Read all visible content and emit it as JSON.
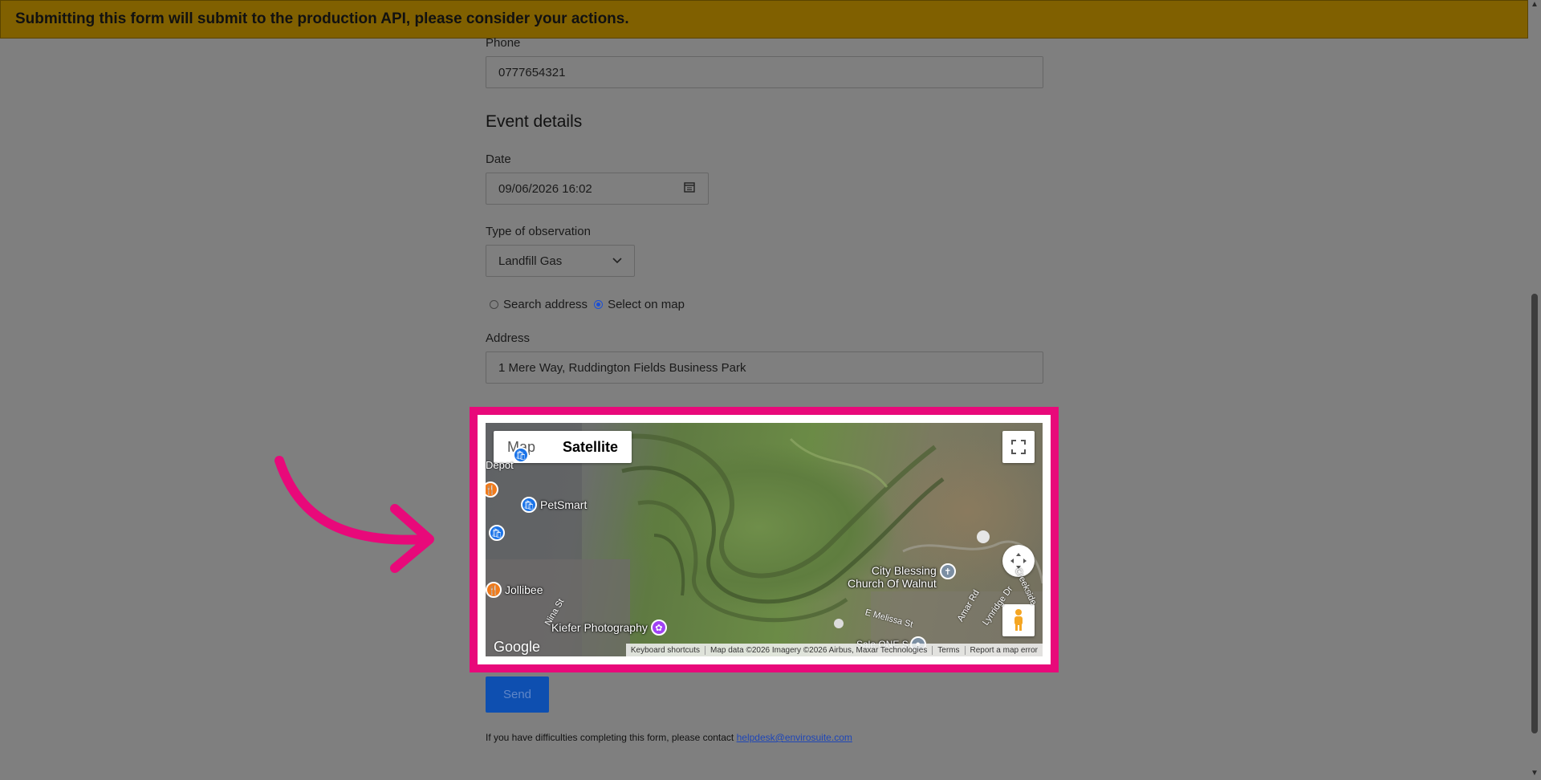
{
  "banner": {
    "text": "Submitting this form will submit to the production API, please consider your actions."
  },
  "phone": {
    "label": "Phone",
    "value": "0777654321"
  },
  "event": {
    "title": "Event details",
    "date_label": "Date",
    "date_value": "09/06/2026 16:02",
    "type_label": "Type of observation",
    "type_value": "Landfill Gas",
    "location_options": [
      {
        "label": "Search address",
        "selected": false
      },
      {
        "label": "Select on map",
        "selected": true
      }
    ],
    "address_label": "Address",
    "address_value": "1 Mere Way, Ruddington Fields Business Park"
  },
  "map": {
    "type_options": [
      "Map",
      "Satellite"
    ],
    "active_type": "Satellite",
    "places": [
      "Depot",
      "PetSmart",
      "Jollibee",
      "Kiefer Photography",
      "City Blessing",
      "Church Of Walnut",
      "Sale ONE S"
    ],
    "streets": [
      "Nina St",
      "E Melissa St",
      "Amar Rd",
      "Lynridge Dr",
      "Creekside"
    ],
    "logo": "Google",
    "attribution": [
      "Keyboard shortcuts",
      "Map data ©2026 Imagery ©2026 Airbus, Maxar Technologies",
      "Terms",
      "Report a map error"
    ],
    "accent": "#e8097a"
  },
  "send_label": "Send",
  "footer": {
    "text": "If you have difficulties completing this form, please contact ",
    "link": "helpdesk@envirosuite.com"
  }
}
